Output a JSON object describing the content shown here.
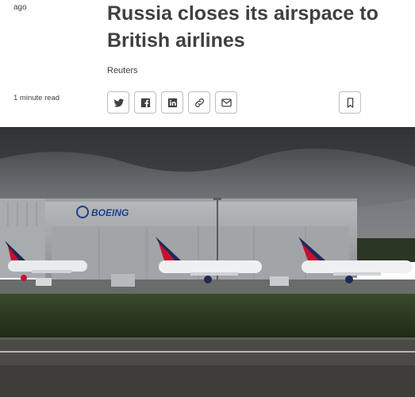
{
  "article": {
    "age_label": "ago",
    "headline": "Russia closes its airspace to British airlines",
    "byline": "Reuters",
    "read_time": "1 minute read"
  },
  "share": {
    "icons": [
      "twitter-icon",
      "facebook-icon",
      "linkedin-icon",
      "link-icon",
      "email-icon"
    ],
    "bookmark_icon": "bookmark-icon"
  },
  "photo": {
    "hangar_sign": "BOEING",
    "sky_color": "#5b5f63",
    "grass_color": "#2f4a22",
    "runway_color": "#4b4a47"
  }
}
